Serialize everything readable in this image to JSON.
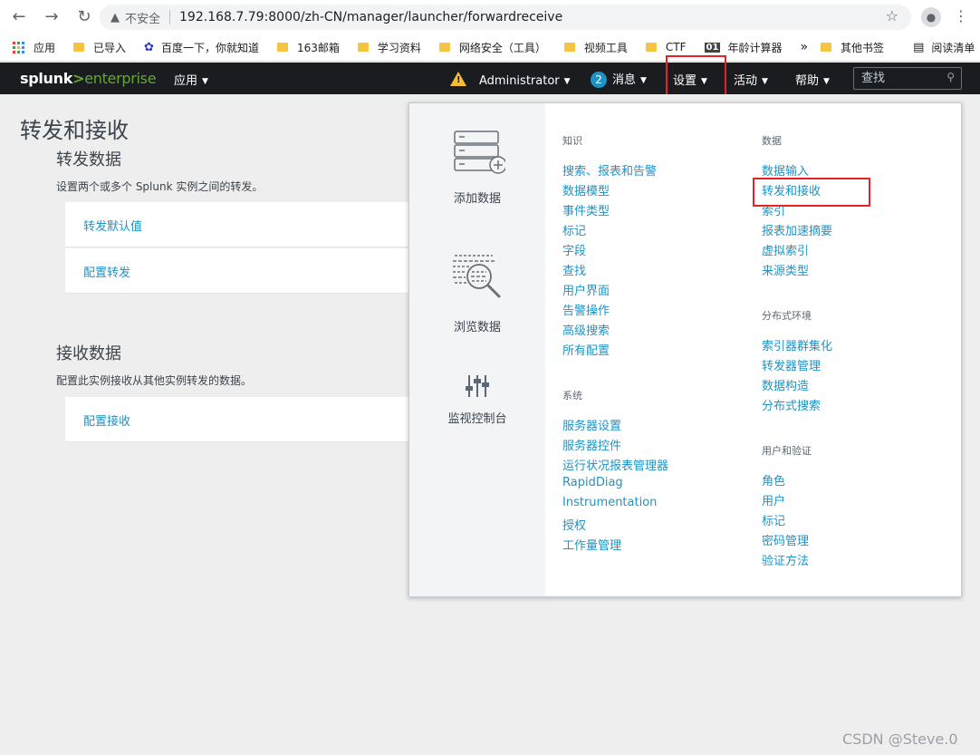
{
  "browser": {
    "insecure_label": "不安全",
    "url": "192.168.7.79:8000/zh-CN/manager/launcher/forwardreceive",
    "bookmarks": [
      "应用",
      "已导入",
      "百度一下，你就知道",
      "163邮箱",
      "学习资料",
      "网络安全（工具）",
      "视频工具",
      "CTF",
      "年龄计算器"
    ],
    "more_label": "»",
    "other_bookmarks": "其他书签",
    "reading_list": "阅读清单",
    "badge_01": "01"
  },
  "header": {
    "logo_main": "splunk",
    "logo_gt": ">",
    "logo_ent": "enterprise",
    "apps": "应用",
    "user": "Administrator",
    "msg_count": "2",
    "messages": "消息",
    "settings": "设置",
    "activity": "活动",
    "help": "帮助",
    "search_placeholder": "查找"
  },
  "page": {
    "title": "转发和接收",
    "forward_title": "转发数据",
    "forward_desc": "设置两个或多个 Splunk 实例之间的转发。",
    "forward_links": [
      "转发默认值",
      "配置转发"
    ],
    "receive_title": "接收数据",
    "receive_desc": "配置此实例接收从其他实例转发的数据。",
    "receive_links": [
      "配置接收"
    ]
  },
  "dropdown": {
    "tiles": [
      "添加数据",
      "浏览数据",
      "监视控制台"
    ],
    "knowledge_title": "知识",
    "knowledge": [
      "搜索、报表和告警",
      "数据模型",
      "事件类型",
      "标记",
      "字段",
      "查找",
      "用户界面",
      "告警操作",
      "高级搜索",
      "所有配置"
    ],
    "system_title": "系统",
    "system": [
      "服务器设置",
      "服务器控件",
      "运行状况报表管理器",
      "RapidDiag",
      "Instrumentation",
      "授权",
      "工作量管理"
    ],
    "data_title": "数据",
    "data": [
      "数据输入",
      "转发和接收",
      "索引",
      "报表加速摘要",
      "虚拟索引",
      "来源类型"
    ],
    "distributed_title": "分布式环境",
    "distributed": [
      "索引器群集化",
      "转发器管理",
      "数据构造",
      "分布式搜索"
    ],
    "users_title": "用户和验证",
    "users": [
      "角色",
      "用户",
      "标记",
      "密码管理",
      "验证方法"
    ]
  },
  "watermark": "CSDN @Steve.0",
  "colors": {
    "link": "#1e93c6",
    "header_bg": "#1a1c20",
    "highlight": "#e8202a",
    "logo_green": "#65a637"
  }
}
